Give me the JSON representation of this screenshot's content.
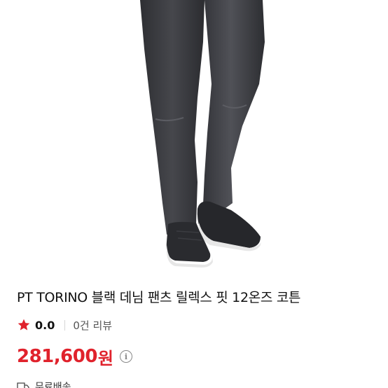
{
  "product": {
    "title": "PT TORINO 블랙 데님 팬츠 릴렉스 핏 12온즈 코튼",
    "rating": "0.0",
    "reviews": "0건 리뷰",
    "price": "281,600",
    "price_unit": "원",
    "shipping": "무료배송"
  },
  "icons": {
    "star": "star-icon",
    "info": "info-icon",
    "truck": "truck-icon"
  },
  "colors": {
    "price": "#e0222c",
    "star": "#e0222c"
  }
}
